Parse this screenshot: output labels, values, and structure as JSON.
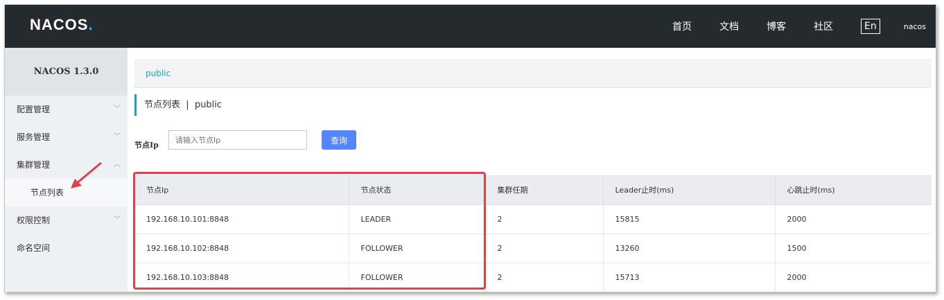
{
  "header": {
    "logo_text": "NACOS",
    "logo_dot": ".",
    "nav": [
      "首页",
      "文档",
      "博客",
      "社区"
    ],
    "lang": "En",
    "user": "nacos"
  },
  "sidebar": {
    "title": "NACOS 1.3.0",
    "items": [
      {
        "label": "配置管理",
        "chevron": "﹀"
      },
      {
        "label": "服务管理",
        "chevron": "﹀"
      },
      {
        "label": "集群管理",
        "chevron": "︿"
      },
      {
        "label": "节点列表"
      },
      {
        "label": "权限控制",
        "chevron": "﹀"
      },
      {
        "label": "命名空间"
      }
    ]
  },
  "breadcrumb": {
    "namespace": "public"
  },
  "page": {
    "title": "节点列表",
    "separator": "|",
    "namespace": "public"
  },
  "search": {
    "label": "节点Ip",
    "placeholder": "请输入节点Ip",
    "button": "查询"
  },
  "table": {
    "headers": [
      "节点Ip",
      "节点状态",
      "集群任期",
      "Leader止时(ms)",
      "心跳止时(ms)"
    ],
    "rows": [
      [
        "192.168.10.101:8848",
        "LEADER",
        "2",
        "15815",
        "2000"
      ],
      [
        "192.168.10.102:8848",
        "FOLLOWER",
        "2",
        "13260",
        "1500"
      ],
      [
        "192.168.10.103:8848",
        "FOLLOWER",
        "2",
        "15713",
        "2000"
      ]
    ]
  },
  "colors": {
    "header_bg": "#252a2f",
    "accent": "#1ba3c8",
    "button": "#5584ff",
    "highlight": "#d9434b"
  }
}
